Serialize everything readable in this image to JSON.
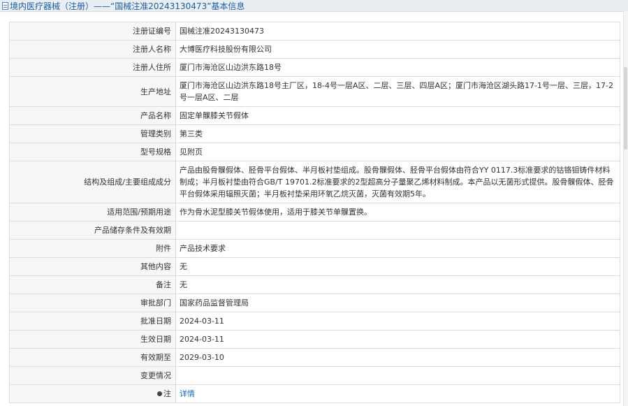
{
  "breadcrumb": {
    "title": "境内医疗器械（注册）——“国械注准20243130473”基本信息"
  },
  "rows": [
    {
      "label": "注册证编号",
      "value": "国械注准20243130473"
    },
    {
      "label": "注册人名称",
      "value": "大博医疗科技股份有限公司"
    },
    {
      "label": "注册人住所",
      "value": "厦门市海沧区山边洪东路18号"
    },
    {
      "label": "生产地址",
      "value": "厦门市海沧区山边洪东路18号主厂区，18-4号一层A区、二层、三层、四层A区；厦门市海沧区湖头路17-1号一层、三层，17-2号一层A区、二层"
    },
    {
      "label": "产品名称",
      "value": "固定单髁膝关节假体"
    },
    {
      "label": "管理类别",
      "value": "第三类"
    },
    {
      "label": "型号规格",
      "value": "见附页"
    },
    {
      "label": "结构及组成/主要组成成分",
      "value": "产品由股骨髁假体、胫骨平台假体、半月板衬垫组成。股骨髁假体、胫骨平台假体由符合YY 0117.3标准要求的钴铬钼铸件材料制成；半月板衬垫由符合GB/T 19701.2标准要求的2型超高分子量聚乙烯材料制成。本产品以无菌形式提供。股骨髁假体、胫骨平台假体采用辐照灭菌；半月板衬垫采用环氧乙烷灭菌，灭菌有效期5年。"
    },
    {
      "label": "适用范围/预期用途",
      "value": "作为骨水泥型膝关节假体使用，适用于膝关节单髁置换。"
    },
    {
      "label": "产品储存条件及有效期",
      "value": ""
    },
    {
      "label": "附件",
      "value": "产品技术要求"
    },
    {
      "label": "其他内容",
      "value": "无"
    },
    {
      "label": "备注",
      "value": "无"
    },
    {
      "label": "审批部门",
      "value": "国家药品监督管理局"
    },
    {
      "label": "批准日期",
      "value": "2024-03-11"
    },
    {
      "label": "生效日期",
      "value": "2024-03-11"
    },
    {
      "label": "有效期至",
      "value": "2029-03-10"
    },
    {
      "label": "变更情况",
      "value": ""
    }
  ],
  "note_row": {
    "label": "注",
    "link_text": "详情"
  },
  "icons": {
    "breadcrumb": "document-icon",
    "note": "pin-icon"
  },
  "colors": {
    "link": "#1a66b3",
    "title": "#1d5c9d",
    "label_bg": "#f7f7f7",
    "border": "#dcdcdc"
  }
}
